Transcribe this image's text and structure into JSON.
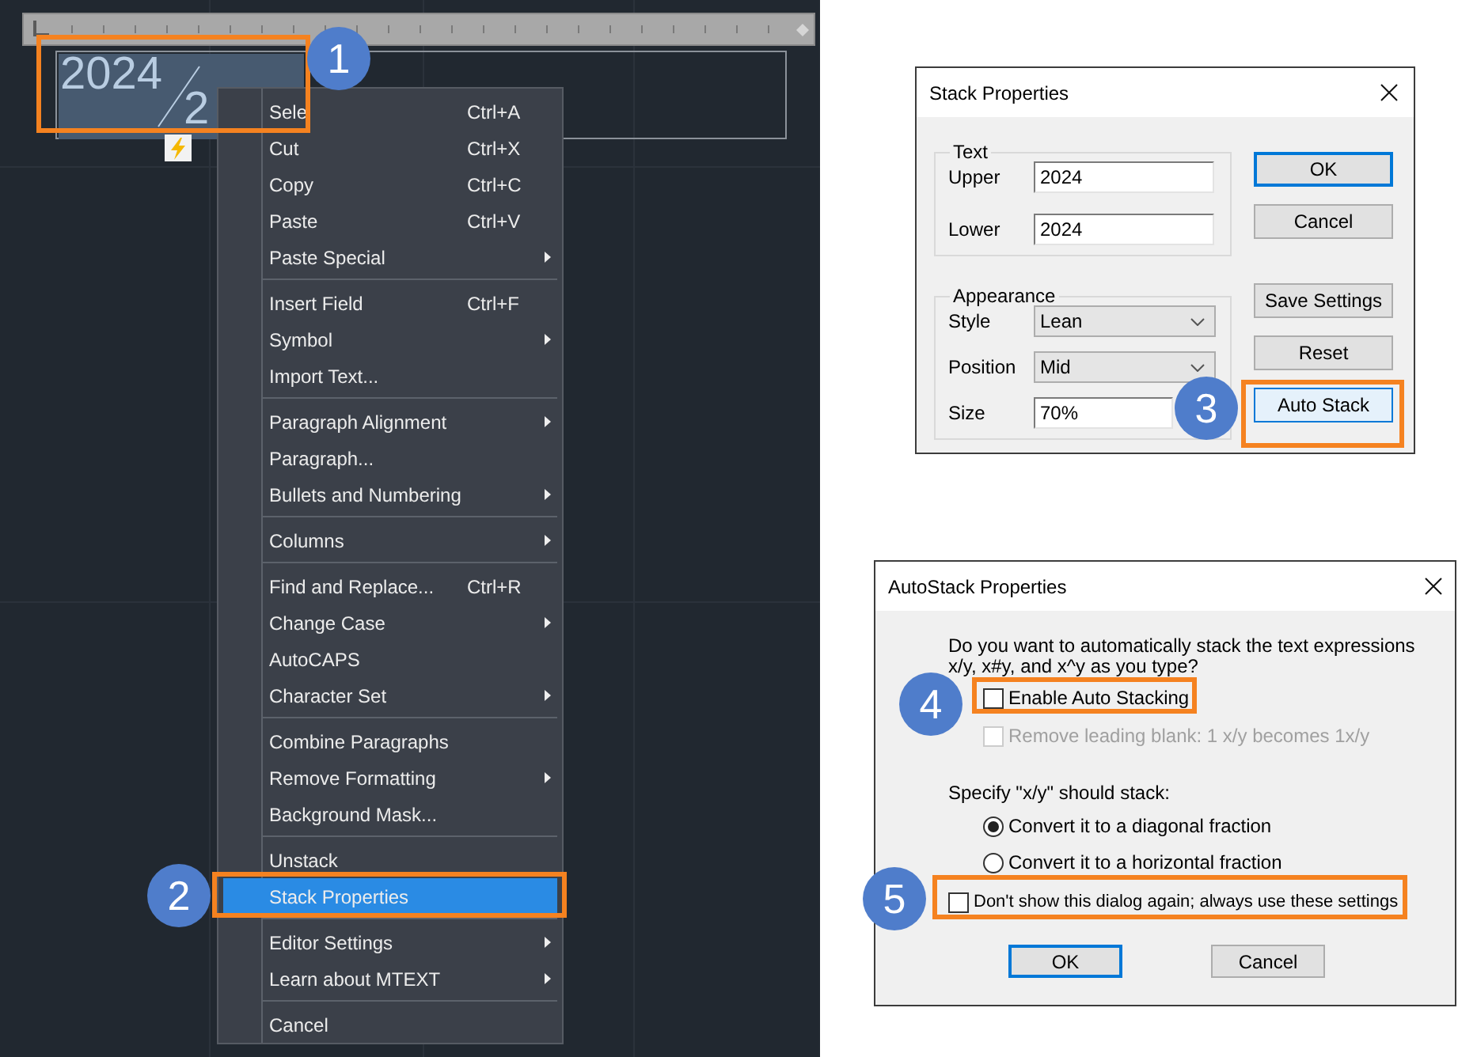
{
  "editor": {
    "upper": "2024",
    "lower": "2"
  },
  "context_menu": {
    "groups": [
      [
        {
          "label": "Sele",
          "shortcut": "Ctrl+A",
          "submenu": false,
          "selected": false
        },
        {
          "label": "Cut",
          "shortcut": "Ctrl+X",
          "submenu": false,
          "selected": false
        },
        {
          "label": "Copy",
          "shortcut": "Ctrl+C",
          "submenu": false,
          "selected": false
        },
        {
          "label": "Paste",
          "shortcut": "Ctrl+V",
          "submenu": false,
          "selected": false
        },
        {
          "label": "Paste Special",
          "submenu": true,
          "selected": false
        }
      ],
      [
        {
          "label": "Insert Field",
          "shortcut": "Ctrl+F",
          "submenu": false,
          "selected": false
        },
        {
          "label": "Symbol",
          "submenu": true,
          "selected": false
        },
        {
          "label": "Import Text...",
          "submenu": false,
          "selected": false
        }
      ],
      [
        {
          "label": "Paragraph Alignment",
          "submenu": true,
          "selected": false
        },
        {
          "label": "Paragraph...",
          "submenu": false,
          "selected": false
        },
        {
          "label": "Bullets and Numbering",
          "submenu": true,
          "selected": false
        }
      ],
      [
        {
          "label": "Columns",
          "submenu": true,
          "selected": false
        }
      ],
      [
        {
          "label": "Find and Replace...",
          "shortcut": "Ctrl+R",
          "submenu": false,
          "selected": false
        },
        {
          "label": "Change Case",
          "submenu": true,
          "selected": false
        },
        {
          "label": "AutoCAPS",
          "submenu": false,
          "selected": false
        },
        {
          "label": "Character Set",
          "submenu": true,
          "selected": false
        }
      ],
      [
        {
          "label": "Combine Paragraphs",
          "submenu": false,
          "selected": false
        },
        {
          "label": "Remove Formatting",
          "submenu": true,
          "selected": false
        },
        {
          "label": "Background Mask...",
          "submenu": false,
          "selected": false
        }
      ],
      [
        {
          "label": "Unstack",
          "submenu": false,
          "selected": false
        },
        {
          "label": "Stack Properties",
          "submenu": false,
          "selected": true
        }
      ],
      [
        {
          "label": "Editor Settings",
          "submenu": true,
          "selected": false
        },
        {
          "label": "Learn about MTEXT",
          "submenu": true,
          "selected": false
        }
      ],
      [
        {
          "label": "Cancel",
          "submenu": false,
          "selected": false
        }
      ]
    ]
  },
  "stack_properties": {
    "title": "Stack Properties",
    "groups": [
      {
        "label": "Text",
        "rows": [
          {
            "kind": "field",
            "label": "Upper",
            "value": "2024"
          },
          {
            "kind": "field",
            "label": "Lower",
            "value": "2024"
          }
        ]
      },
      {
        "label": "Appearance",
        "rows": [
          {
            "kind": "dropdown",
            "label": "Style",
            "value": "Lean"
          },
          {
            "kind": "dropdown",
            "label": "Position",
            "value": "Mid"
          },
          {
            "kind": "field",
            "label": "Size",
            "value": "70%"
          }
        ]
      }
    ],
    "button_groups": [
      [
        {
          "label": "OK",
          "default": true,
          "hovered": false
        },
        {
          "label": "Cancel",
          "default": false,
          "hovered": false
        }
      ],
      [
        {
          "label": "Save Settings",
          "default": false,
          "hovered": false
        },
        {
          "label": "Reset",
          "default": false,
          "hovered": false
        },
        {
          "label": "Auto Stack",
          "default": false,
          "hovered": true
        }
      ]
    ]
  },
  "autostack_properties": {
    "title": "AutoStack Properties",
    "question": [
      "Do you want to automatically stack the text expressions",
      "x/y, x#y, and x^y as you type?"
    ],
    "options": [
      {
        "label": "Enable Auto Stacking",
        "checked": false,
        "disabled": false
      },
      {
        "label": "Remove leading blank: 1 x/y becomes 1x/y",
        "checked": false,
        "disabled": true
      }
    ],
    "stack_prompt": "Specify \"x/y\" should stack:",
    "fractions": [
      {
        "label": "Convert it to a diagonal fraction",
        "selected": true
      },
      {
        "label": "Convert it to a horizontal fraction",
        "selected": false
      }
    ],
    "dont_show": {
      "label": "Don't show this dialog again; always use these settings",
      "checked": false
    },
    "buttons": [
      {
        "label": "OK",
        "default": true
      },
      {
        "label": "Cancel",
        "default": false
      }
    ]
  },
  "callouts": [
    "1",
    "2",
    "3",
    "4",
    "5"
  ]
}
